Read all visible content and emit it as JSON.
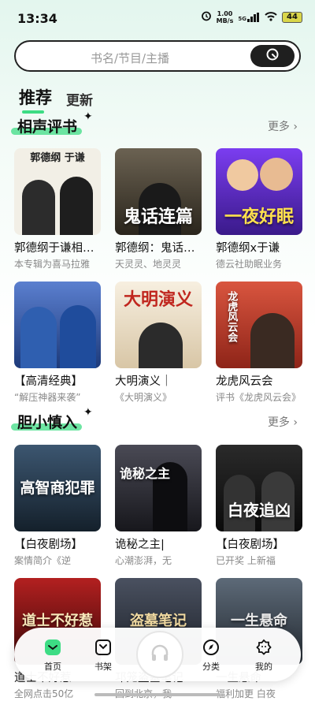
{
  "status": {
    "time": "13:34",
    "net_speed_top": "1.00",
    "net_speed_bottom": "MB/s",
    "signal": "5G",
    "battery": "44"
  },
  "search": {
    "placeholder": "书名/节目/主播"
  },
  "tabs": [
    {
      "label": "推荐"
    },
    {
      "label": "更新"
    }
  ],
  "sections": [
    {
      "title": "相声评书",
      "more": "更多",
      "items": [
        {
          "title": "郭德纲于谦相声集",
          "subtitle": "本专辑为喜马拉雅",
          "cover_text": "郭德纲 于谦",
          "cover_color": "#f2efe6"
        },
        {
          "title": "郭德纲：鬼话连篇",
          "subtitle": "天灵灵、地灵灵",
          "cover_text": "鬼话连篇",
          "cover_color": "#3a3326"
        },
        {
          "title": "郭德纲x于谦",
          "subtitle": "德云社助眠业务",
          "cover_text": "一夜好眠",
          "cover_color": "#5b2bbf"
        },
        {
          "title": "【高清经典】",
          "subtitle": "“解压神器来袭”",
          "cover_text": "",
          "cover_color": "#2d4f9a"
        },
        {
          "title": "大明演义｜",
          "subtitle": "《大明演义》",
          "cover_text": "大明演义",
          "cover_color": "#f4e9d8"
        },
        {
          "title": "龙虎风云会",
          "subtitle": "评书《龙虎风云会》",
          "cover_text": "龙虎风云会",
          "cover_color": "#b23a2e"
        }
      ]
    },
    {
      "title": "胆小慎入",
      "more": "更多",
      "items": [
        {
          "title": "【白夜剧场】",
          "subtitle": "案情简介《逆",
          "cover_text": "高智商犯罪",
          "cover_color": "#1f2e3d"
        },
        {
          "title": "诡秘之主|",
          "subtitle": "心潮澎湃，无",
          "cover_text": "诡秘之主",
          "cover_color": "#2b2b33"
        },
        {
          "title": "【白夜剧场】",
          "subtitle": "已开奖 上新福",
          "cover_text": "白夜追凶",
          "cover_color": "#151515"
        },
        {
          "title": "道士不好惹",
          "subtitle": "全网点击50亿",
          "cover_text": "道士不好惹",
          "cover_color": "#7a1111"
        },
        {
          "title": "邛笼盗墓笔记",
          "subtitle": "回到北京，我",
          "cover_text": "盗墓笔记",
          "cover_color": "#2a2f3a"
        },
        {
          "title": "一生悬命",
          "subtitle": "福利加更 白夜",
          "cover_text": "一生悬命",
          "cover_color": "#3b4450"
        }
      ]
    }
  ],
  "bottom_nav": [
    {
      "label": "首页",
      "icon": "home-icon"
    },
    {
      "label": "书架",
      "icon": "bookshelf-icon"
    },
    {
      "label": "分类",
      "icon": "compass-icon"
    },
    {
      "label": "我的",
      "icon": "profile-icon"
    }
  ]
}
